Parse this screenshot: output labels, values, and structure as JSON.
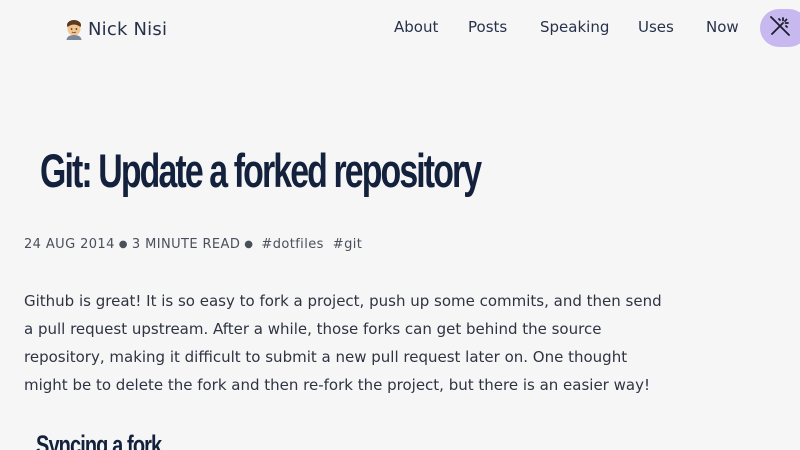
{
  "site": {
    "name": "Nick Nisi",
    "logo_icon": "person-emoji-icon"
  },
  "nav": {
    "items": [
      {
        "label": "About"
      },
      {
        "label": "Posts"
      },
      {
        "label": "Speaking"
      },
      {
        "label": "Uses"
      },
      {
        "label": "Now"
      }
    ],
    "theme_toggle_icon": "magic-wand-off-icon"
  },
  "post": {
    "title": "Git: Update a forked repository",
    "date": "24 AUG 2014",
    "reading_time": "3 MINUTE READ",
    "tags": [
      "#dotfiles",
      "#git"
    ],
    "intro": "Github is great! It is so easy to fork a project, push up some commits, and then send a pull request upstream. After a while, those forks can get behind the source repository, making it difficult to submit a new pull request later on. One thought might be to delete the fork and then re-fork the project, but there is an easier way!",
    "section_heading": "Syncing a fork"
  },
  "colors": {
    "background": "#f6f6f6",
    "heading": "#13213d",
    "toggle_bg": "#c8b8f0"
  }
}
